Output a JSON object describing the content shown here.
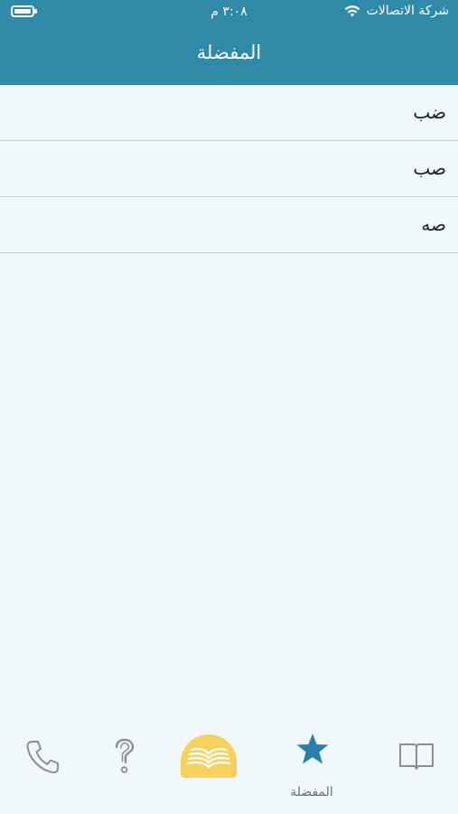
{
  "status_bar": {
    "time": "٣:٠٨ م",
    "carrier": "شركة الاتصالات"
  },
  "header": {
    "title": "المفضلة"
  },
  "favorites": {
    "items": [
      {
        "label": "ضب"
      },
      {
        "label": "صب"
      },
      {
        "label": "صه"
      }
    ]
  },
  "tabbar": {
    "tabs": [
      {
        "icon": "phone-icon"
      },
      {
        "icon": "question-icon"
      },
      {
        "icon": "book-home-icon"
      },
      {
        "icon": "star-icon",
        "label": "المفضلة",
        "active": true
      },
      {
        "icon": "open-book-icon"
      }
    ]
  },
  "colors": {
    "header": "#2e8aa6",
    "background": "#f1f8fb",
    "active_tab": "#2b7fad",
    "home_badge": "#f7d15b"
  }
}
